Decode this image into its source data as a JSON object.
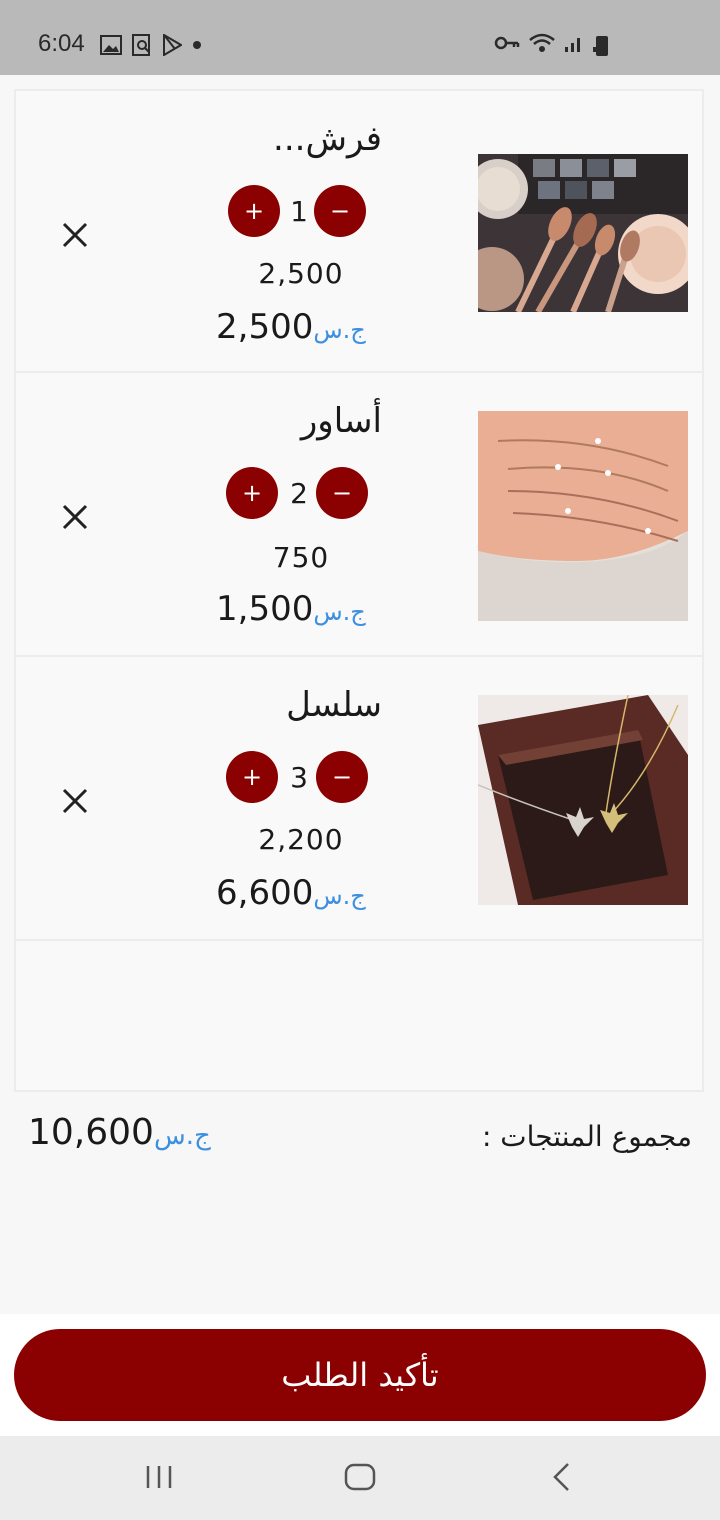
{
  "status_bar": {
    "time": "6:04",
    "icons": [
      "image-icon",
      "search-document-icon",
      "play-store-icon",
      "dot-icon",
      "key-icon",
      "wifi-icon",
      "signal-icon",
      "signal-icon",
      "battery-icon"
    ]
  },
  "cart": {
    "currency": "ج.س",
    "items": [
      {
        "name": "فرش...",
        "quantity": "1",
        "unit_price": "2,500",
        "total": "2,500",
        "image": "makeup-brushes"
      },
      {
        "name": "أساور",
        "quantity": "2",
        "unit_price": "750",
        "total": "1,500",
        "image": "bracelets"
      },
      {
        "name": "سلسل",
        "quantity": "3",
        "unit_price": "2,200",
        "total": "6,600",
        "image": "necklaces"
      }
    ]
  },
  "summary": {
    "label": "مجموع المنتجات :",
    "total": "10,600",
    "currency": "ج.س"
  },
  "actions": {
    "confirm_label": "تأكيد الطلب"
  },
  "nav": {
    "icons": [
      "recent-apps-icon",
      "home-icon",
      "back-icon"
    ]
  },
  "colors": {
    "accent": "#8b0000",
    "currency": "#3d8fe0"
  }
}
